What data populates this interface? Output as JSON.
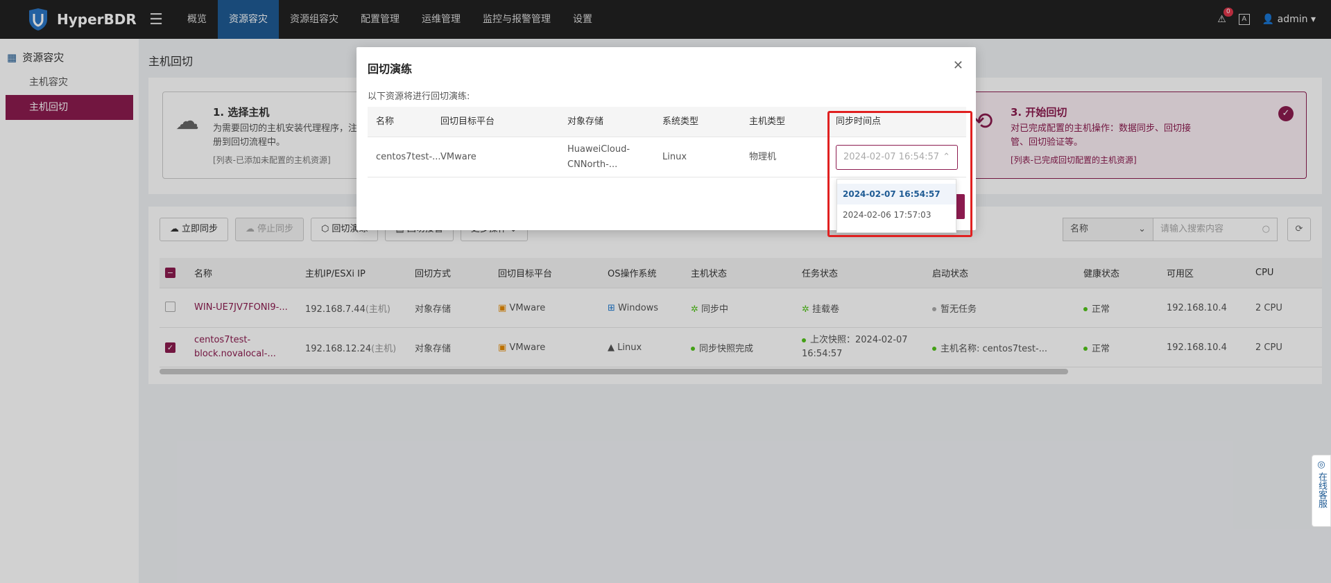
{
  "app": {
    "name": "HyperBDR"
  },
  "nav": [
    "概览",
    "资源容灾",
    "资源组容灾",
    "配置管理",
    "运维管理",
    "监控与报警管理",
    "设置"
  ],
  "top_right": {
    "alert_count": "0",
    "lang": "A",
    "user": "admin"
  },
  "sidebar": {
    "title": "资源容灾",
    "items": [
      "主机容灾",
      "主机回切"
    ]
  },
  "page_title": "主机回切",
  "steps": [
    {
      "title": "1. 选择主机",
      "desc": "为需要回切的主机安装代理程序，注册到回切流程中。",
      "note": "[列表-已添加未配置的主机资源]"
    },
    {
      "title": "3. 开始回切",
      "desc": "对已完成配置的主机操作：数据同步、回切接管、回切验证等。",
      "note": "[列表-已完成回切配置的主机资源]"
    }
  ],
  "toolbar": {
    "sync_now": "立即同步",
    "stop_sync": "停止同步",
    "drill": "回切演练",
    "takeover": "回切接管",
    "more": "更多操作"
  },
  "search": {
    "field": "名称",
    "placeholder": "请输入搜索内容"
  },
  "table": {
    "headers": [
      "名称",
      "主机IP/ESXi IP",
      "回切方式",
      "回切目标平台",
      "OS操作系统",
      "主机状态",
      "任务状态",
      "启动状态",
      "健康状态",
      "可用区",
      "CPU"
    ],
    "rows": [
      {
        "name": "WIN-UE7JV7FONI9-...",
        "ip": "192.168.7.44",
        "ip_tag": "(主机)",
        "mode": "对象存储",
        "target": "VMware",
        "os": "Windows",
        "host_status": "同步中",
        "task_status": "挂载卷",
        "boot_status": "暂无任务",
        "health": "正常",
        "zone": "192.168.10.4",
        "cpu": "2 CPU",
        "checked": false
      },
      {
        "name": "centos7test-block.novalocal-...",
        "ip": "192.168.12.24",
        "ip_tag": "(主机)",
        "mode": "对象存储",
        "target": "VMware",
        "os": "Linux",
        "host_status": "同步快照完成",
        "task_status": "上次快照：2024-02-07 16:54:57",
        "boot_status": "主机名称: centos7test-...",
        "health": "正常",
        "zone": "192.168.10.4",
        "cpu": "2 CPU",
        "checked": true
      }
    ]
  },
  "modal": {
    "title": "回切演练",
    "subtitle": "以下资源将进行回切演练:",
    "headers": [
      "名称",
      "回切目标平台",
      "对象存储",
      "系统类型",
      "主机类型",
      "同步时间点"
    ],
    "row": {
      "name": "centos7test-...",
      "target": "VMware",
      "storage": "HuaweiCloud-CNNorth-...",
      "os_type": "Linux",
      "host_type": "物理机",
      "sync_time": "2024-02-07 16:54:57"
    },
    "dropdown": [
      "2024-02-07 16:54:57",
      "2024-02-06 17:57:03"
    ]
  },
  "support": "在线客服",
  "colors": {
    "brand": "#8c1b4f",
    "nav_active": "#1f5b94",
    "highlight": "#e02020"
  }
}
